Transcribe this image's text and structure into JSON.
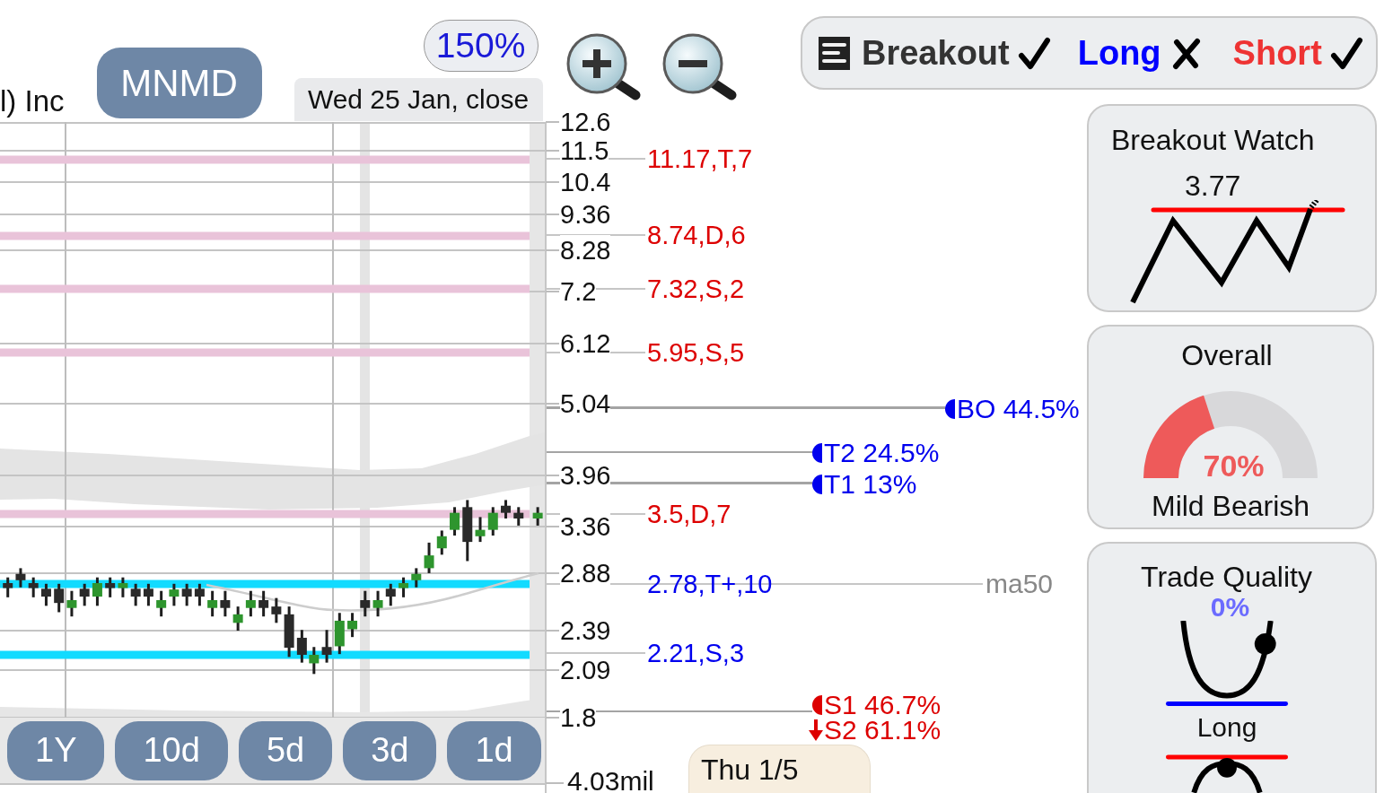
{
  "header": {
    "company": "l) Inc",
    "symbol": "MNMD",
    "zoom": "150%",
    "date": "Wed 25 Jan, close"
  },
  "chart": {
    "price_ticks": [
      "12.6",
      "11.5",
      "10.4",
      "9.36",
      "8.28",
      "7.2",
      "6.12",
      "5.04",
      "3.96",
      "3.36",
      "2.88",
      "2.39",
      "2.09",
      "1.8"
    ],
    "levels": [
      {
        "label": "11.17,T,7",
        "kind": "resistance"
      },
      {
        "label": "8.74,D,6",
        "kind": "resistance"
      },
      {
        "label": "7.32,S,2",
        "kind": "resistance"
      },
      {
        "label": "5.95,S,5",
        "kind": "resistance"
      },
      {
        "label": "3.5,D,7",
        "kind": "resistance"
      },
      {
        "label": "2.78,T+,10",
        "kind": "support"
      },
      {
        "label": "2.21,S,3",
        "kind": "support"
      }
    ],
    "ma_label": "ma50",
    "targets": [
      {
        "label": "BO 44.5%",
        "kind": "disc",
        "color": "#0000ee"
      },
      {
        "label": "T2 24.5%",
        "kind": "disc",
        "color": "#0000ee"
      },
      {
        "label": "T1 13%",
        "kind": "disc",
        "color": "#0000ee"
      },
      {
        "label": "S1 46.7%",
        "kind": "disc",
        "color": "#dd0000"
      },
      {
        "label": "S2 61.1%",
        "kind": "arrow",
        "color": "#dd0000"
      }
    ],
    "volume_label": "4.03mil",
    "cursor_date": "Thu 1/5",
    "timeframes": [
      "1Y",
      "10d",
      "5d",
      "3d",
      "1d"
    ]
  },
  "signals": [
    {
      "label": "Breakout",
      "color": "#333333",
      "checked": true
    },
    {
      "label": "Long",
      "color": "#0000ff",
      "checked": false
    },
    {
      "label": "Short",
      "color": "#ee3333",
      "checked": true
    }
  ],
  "breakout_watch": {
    "title": "Breakout Watch",
    "value": "3.77"
  },
  "overall": {
    "title": "Overall",
    "level": 0.4,
    "reading": "70%",
    "verdict": "Mild Bearish"
  },
  "trade_quality": {
    "title": "Trade Quality",
    "reading": "0%",
    "pattern_label": "Long"
  }
}
